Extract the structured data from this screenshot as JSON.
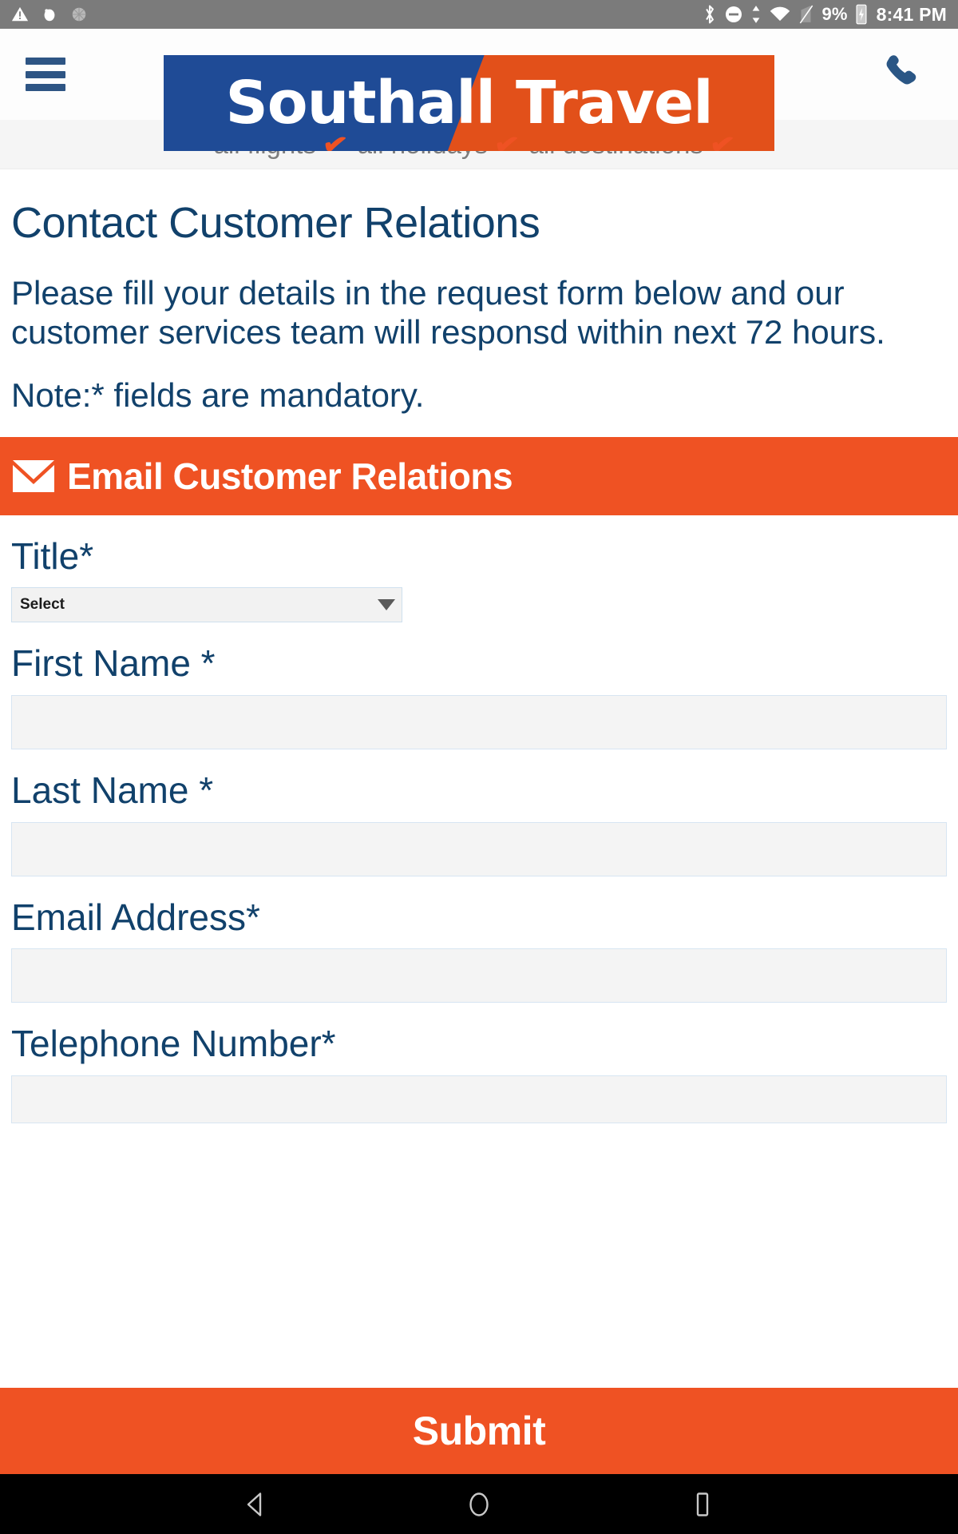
{
  "status_bar": {
    "icons_left": [
      "warning-triangle-icon",
      "cloud-icon",
      "circle-icon"
    ],
    "icons_right": [
      "bluetooth-icon",
      "do-not-disturb-icon",
      "sync-arrows-icon",
      "wifi-icon",
      "signal-off-icon"
    ],
    "battery_percent": "9%",
    "battery_icon": "battery-charging-icon",
    "time": "8:41 PM"
  },
  "header": {
    "menu_icon": "hamburger-menu-icon",
    "logo_primary": "Southall",
    "logo_secondary": "Travel",
    "phone_icon": "phone-icon",
    "brand_blue": "#1f4b96",
    "brand_orange": "#e2501a"
  },
  "tagline": {
    "items": [
      {
        "label": "all flights",
        "check": "✔"
      },
      {
        "label": "all holidays",
        "check": "✔"
      },
      {
        "label": "all destinations",
        "check": "✔"
      }
    ],
    "check_color": "#ef5223"
  },
  "page": {
    "title": "Contact Customer Relations",
    "intro": "Please fill your details in the request form below and our customer services team will responsd within next 72 hours.",
    "note": "Note:* fields are mandatory.",
    "heading_color": "#11416b"
  },
  "section": {
    "icon": "envelope-icon",
    "title": "Email Customer Relations",
    "background": "#ef5223"
  },
  "form": {
    "fields": [
      {
        "label": "Title*",
        "type": "select",
        "value": "Select"
      },
      {
        "label": "First Name *",
        "type": "text",
        "value": ""
      },
      {
        "label": "Last Name *",
        "type": "text",
        "value": ""
      },
      {
        "label": "Email Address*",
        "type": "text",
        "value": ""
      },
      {
        "label": "Telephone Number*",
        "type": "text",
        "value": ""
      }
    ],
    "submit_label": "Submit"
  },
  "nav_bar": {
    "back_icon": "back-triangle-icon",
    "home_icon": "home-circle-icon",
    "recents_icon": "recents-square-icon"
  }
}
